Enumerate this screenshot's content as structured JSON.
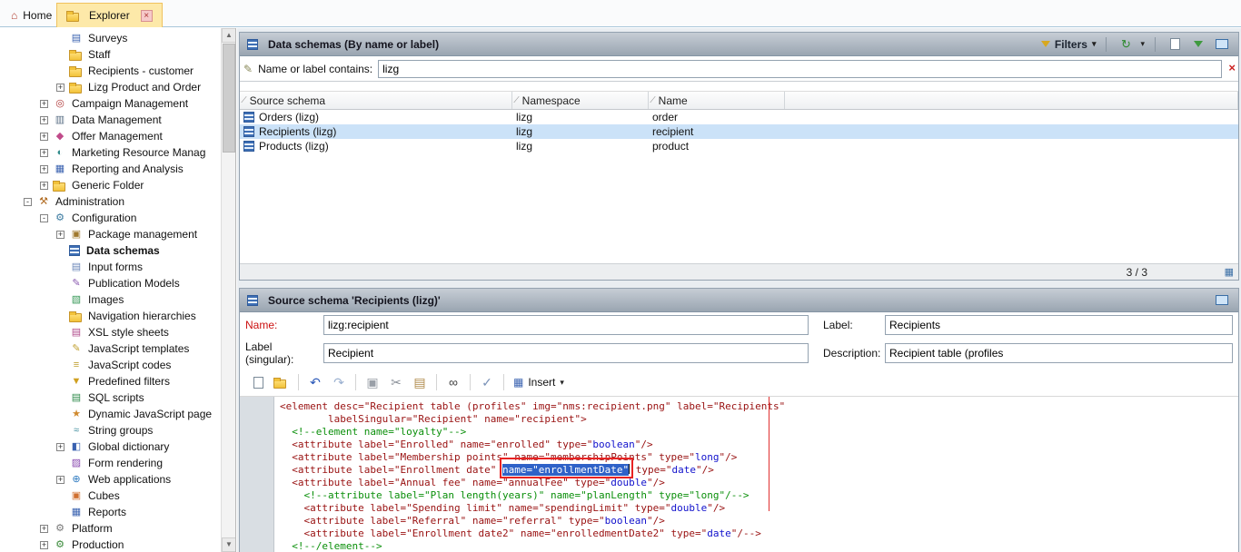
{
  "app": {
    "tabs": [
      {
        "label": "Home",
        "icon": "home-icon"
      },
      {
        "label": "Explorer",
        "icon": "folder-icon",
        "active": true,
        "close": "×"
      }
    ]
  },
  "tree": {
    "items": [
      {
        "label": "Surveys",
        "icon": "survey-icon",
        "indent": 2
      },
      {
        "label": "Staff",
        "icon": "folder-icon",
        "indent": 2
      },
      {
        "label": "Recipients - customer",
        "icon": "folder-icon",
        "indent": 2
      },
      {
        "label": "Lizg Product and Order",
        "icon": "folder-icon",
        "indent": 2,
        "expander": "+"
      },
      {
        "label": "Campaign Management",
        "icon": "campaign-icon",
        "indent": 1,
        "expander": "+"
      },
      {
        "label": "Data Management",
        "icon": "data-icon",
        "indent": 1,
        "expander": "+"
      },
      {
        "label": "Offer Management",
        "icon": "offer-icon",
        "indent": 1,
        "expander": "+"
      },
      {
        "label": "Marketing Resource Manag",
        "icon": "mrm-icon",
        "indent": 1,
        "expander": "+"
      },
      {
        "label": "Reporting and Analysis",
        "icon": "report-icon",
        "indent": 1,
        "expander": "+"
      },
      {
        "label": "Generic Folder",
        "icon": "folder-icon",
        "indent": 1,
        "expander": "+"
      },
      {
        "label": "Administration",
        "icon": "admin-icon",
        "indent": 0,
        "expander": "-"
      },
      {
        "label": "Configuration",
        "icon": "config-icon",
        "indent": 1,
        "expander": "-"
      },
      {
        "label": "Package management",
        "icon": "package-icon",
        "indent": 2,
        "expander": "+"
      },
      {
        "label": "Data schemas",
        "icon": "schema-icon",
        "indent": 2,
        "bold": true,
        "selected": true
      },
      {
        "label": "Input forms",
        "icon": "form-icon",
        "indent": 2
      },
      {
        "label": "Publication Models",
        "icon": "publication-icon",
        "indent": 2
      },
      {
        "label": "Images",
        "icon": "image-icon",
        "indent": 2
      },
      {
        "label": "Navigation hierarchies",
        "icon": "hierarchy-icon",
        "indent": 2
      },
      {
        "label": "XSL style sheets",
        "icon": "xsl-icon",
        "indent": 2
      },
      {
        "label": "JavaScript templates",
        "icon": "js-template-icon",
        "indent": 2
      },
      {
        "label": "JavaScript codes",
        "icon": "js-code-icon",
        "indent": 2
      },
      {
        "label": "Predefined filters",
        "icon": "filter-icon",
        "indent": 2
      },
      {
        "label": "SQL scripts",
        "icon": "sql-icon",
        "indent": 2
      },
      {
        "label": "Dynamic JavaScript page",
        "icon": "dynamic-js-icon",
        "indent": 2
      },
      {
        "label": "String groups",
        "icon": "string-icon",
        "indent": 2
      },
      {
        "label": "Global dictionary",
        "icon": "dictionary-icon",
        "indent": 2,
        "expander": "+"
      },
      {
        "label": "Form rendering",
        "icon": "form-rendering-icon",
        "indent": 2
      },
      {
        "label": "Web applications",
        "icon": "webapp-icon",
        "indent": 2,
        "expander": "+"
      },
      {
        "label": "Cubes",
        "icon": "cube-icon",
        "indent": 2
      },
      {
        "label": "Reports",
        "icon": "report-icon",
        "indent": 2
      },
      {
        "label": "Platform",
        "icon": "platform-icon",
        "indent": 1,
        "expander": "+"
      },
      {
        "label": "Production",
        "icon": "production-icon",
        "indent": 1,
        "expander": "+"
      }
    ]
  },
  "list_panel": {
    "title": "Data schemas (By name or label)",
    "filters_label": "Filters",
    "search_label": "Name or label contains:",
    "search_value": "lizg",
    "columns": [
      "Source schema",
      "Namespace",
      "Name"
    ],
    "rows": [
      {
        "schema": "Orders (lizg)",
        "namespace": "lizg",
        "name": "order",
        "selected": false
      },
      {
        "schema": "Recipients (lizg)",
        "namespace": "lizg",
        "name": "recipient",
        "selected": true
      },
      {
        "schema": "Products (lizg)",
        "namespace": "lizg",
        "name": "product",
        "selected": false
      }
    ],
    "count": "3 / 3"
  },
  "detail_panel": {
    "title": "Source schema 'Recipients (lizg)'",
    "fields": {
      "name_label": "Name:",
      "name_value": "lizg:recipient",
      "label_label": "Label:",
      "label_value": "Recipients",
      "singular_label": "Label (singular):",
      "singular_value": "Recipient",
      "description_label": "Description:",
      "description_value": "Recipient table (profiles"
    },
    "toolbar": {
      "insert_label": "Insert"
    },
    "code": {
      "lines": [
        {
          "segs": [
            {
              "s": "x",
              "t": "<element desc=\"Recipient table (profiles\" img=\"nms:recipient.png\" label=\"Recipients\""
            }
          ]
        },
        {
          "segs": [
            {
              "s": "x",
              "t": "        labelSingular=\"Recipient\" name=\"recipient\">"
            }
          ]
        },
        {
          "segs": [
            {
              "s": "c",
              "t": "  <!--element name=\"loyalty\"-->"
            }
          ]
        },
        {
          "segs": [
            {
              "s": "x",
              "t": "  <attribute label=\"Enrolled\" name=\"enrolled\" type=\""
            },
            {
              "s": "v",
              "t": "boolean"
            },
            {
              "s": "x",
              "t": "\"/>"
            }
          ]
        },
        {
          "segs": [
            {
              "s": "x",
              "t": "  <attribute label=\"Membership points\" name=\"membershipPoints\" type=\""
            },
            {
              "s": "v",
              "t": "long"
            },
            {
              "s": "x",
              "t": "\"/>"
            }
          ]
        },
        {
          "segs": [
            {
              "s": "x",
              "t": "  <attribute label=\"Enrollment date\" "
            },
            {
              "s": "sel",
              "t": "name=\"enrollmentDate\""
            },
            {
              "s": "x",
              "t": " type=\""
            },
            {
              "s": "v",
              "t": "date"
            },
            {
              "s": "x",
              "t": "\"/>"
            }
          ]
        },
        {
          "segs": [
            {
              "s": "x",
              "t": "  <attribute label=\"Annual fee\" name=\"annualFee\" type=\""
            },
            {
              "s": "v",
              "t": "double"
            },
            {
              "s": "x",
              "t": "\"/>"
            }
          ]
        },
        {
          "segs": [
            {
              "s": "c",
              "t": "    <!--attribute label=\"Plan length(years)\" name=\"planLength\" type=\"long\"/-->"
            }
          ]
        },
        {
          "segs": [
            {
              "s": "x",
              "t": "    <attribute label=\"Spending limit\" name=\"spendingLimit\" type=\""
            },
            {
              "s": "v",
              "t": "double"
            },
            {
              "s": "x",
              "t": "\"/>"
            }
          ]
        },
        {
          "segs": [
            {
              "s": "x",
              "t": "    <attribute label=\"Referral\" name=\"referral\" type=\""
            },
            {
              "s": "v",
              "t": "boolean"
            },
            {
              "s": "x",
              "t": "\"/>"
            }
          ]
        },
        {
          "segs": [
            {
              "s": "x",
              "t": "    <attribute label=\"Enrollment date2\" name=\"enrolledmentDate2\" type=\""
            },
            {
              "s": "v",
              "t": "date"
            },
            {
              "s": "x",
              "t": "\"/-->"
            }
          ]
        },
        {
          "segs": [
            {
              "s": "c",
              "t": "  <!--/element-->"
            }
          ]
        }
      ]
    }
  }
}
